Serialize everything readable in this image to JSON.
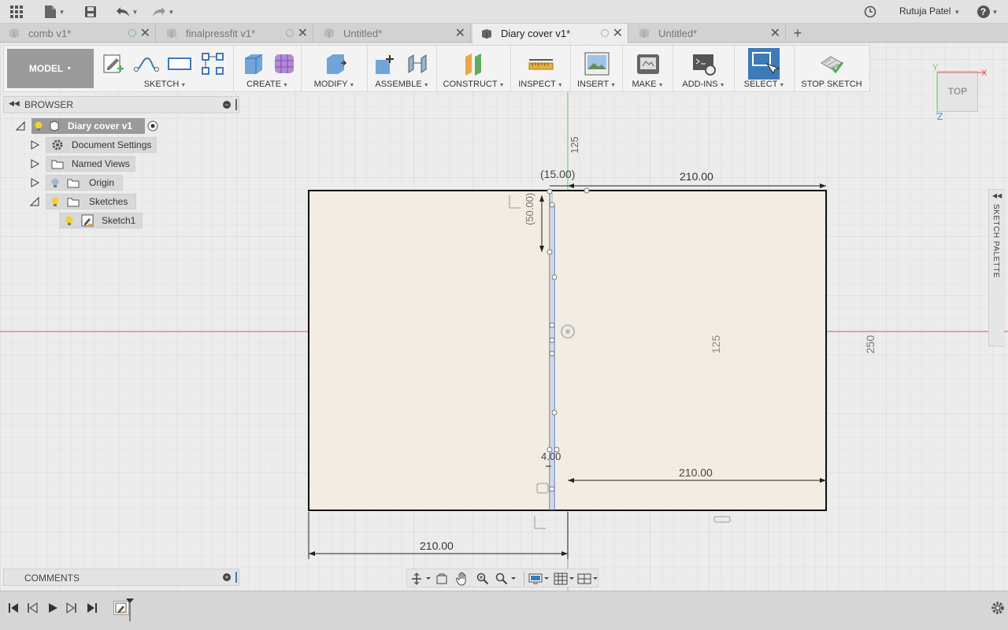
{
  "app": {
    "user_name": "Rutuja Patel",
    "help_label": "?"
  },
  "tabs": [
    {
      "label": "comb v1*",
      "active": false,
      "has_dot": true
    },
    {
      "label": "finalpressfit v1*",
      "active": false,
      "has_dot": true
    },
    {
      "label": "Untitled*",
      "active": false,
      "has_dot": false
    },
    {
      "label": "Diary cover v1*",
      "active": true,
      "has_dot": true
    },
    {
      "label": "Untitled*",
      "active": false,
      "has_dot": false
    }
  ],
  "toolbar": {
    "model_label": "MODEL",
    "groups": [
      {
        "label": "SKETCH"
      },
      {
        "label": "CREATE"
      },
      {
        "label": "MODIFY"
      },
      {
        "label": "ASSEMBLE"
      },
      {
        "label": "CONSTRUCT"
      },
      {
        "label": "INSPECT"
      },
      {
        "label": "INSERT"
      },
      {
        "label": "MAKE"
      },
      {
        "label": "ADD-INS"
      },
      {
        "label": "SELECT"
      },
      {
        "label": "STOP SKETCH"
      }
    ]
  },
  "browser": {
    "title": "BROWSER",
    "items": [
      {
        "label": "Diary cover v1"
      },
      {
        "label": "Document Settings"
      },
      {
        "label": "Named Views"
      },
      {
        "label": "Origin"
      },
      {
        "label": "Sketches"
      },
      {
        "label": "Sketch1"
      }
    ]
  },
  "comments": {
    "title": "COMMENTS"
  },
  "palette": {
    "title": "SKETCH PALETTE"
  },
  "viewcube": {
    "label": "TOP",
    "axis_x": "X",
    "axis_y": "Y",
    "axis_z": "Z"
  },
  "dimensions": {
    "top_width": "210.00",
    "top_offset": "(15.00)",
    "top_small": "125",
    "left_vertical": "(50.00)",
    "center_height": "125",
    "right_height": "250",
    "slot_width": "4.00",
    "inner_width": "210.00",
    "bottom_width": "210.00"
  },
  "colors": {
    "sketch_fill": "#f3ece2",
    "sketch_stroke": "#111111",
    "construction_blue": "#5a82d6",
    "axis_red": "#e05a5a",
    "axis_green": "#6ec86e",
    "select_blue": "#3d7ab8"
  }
}
